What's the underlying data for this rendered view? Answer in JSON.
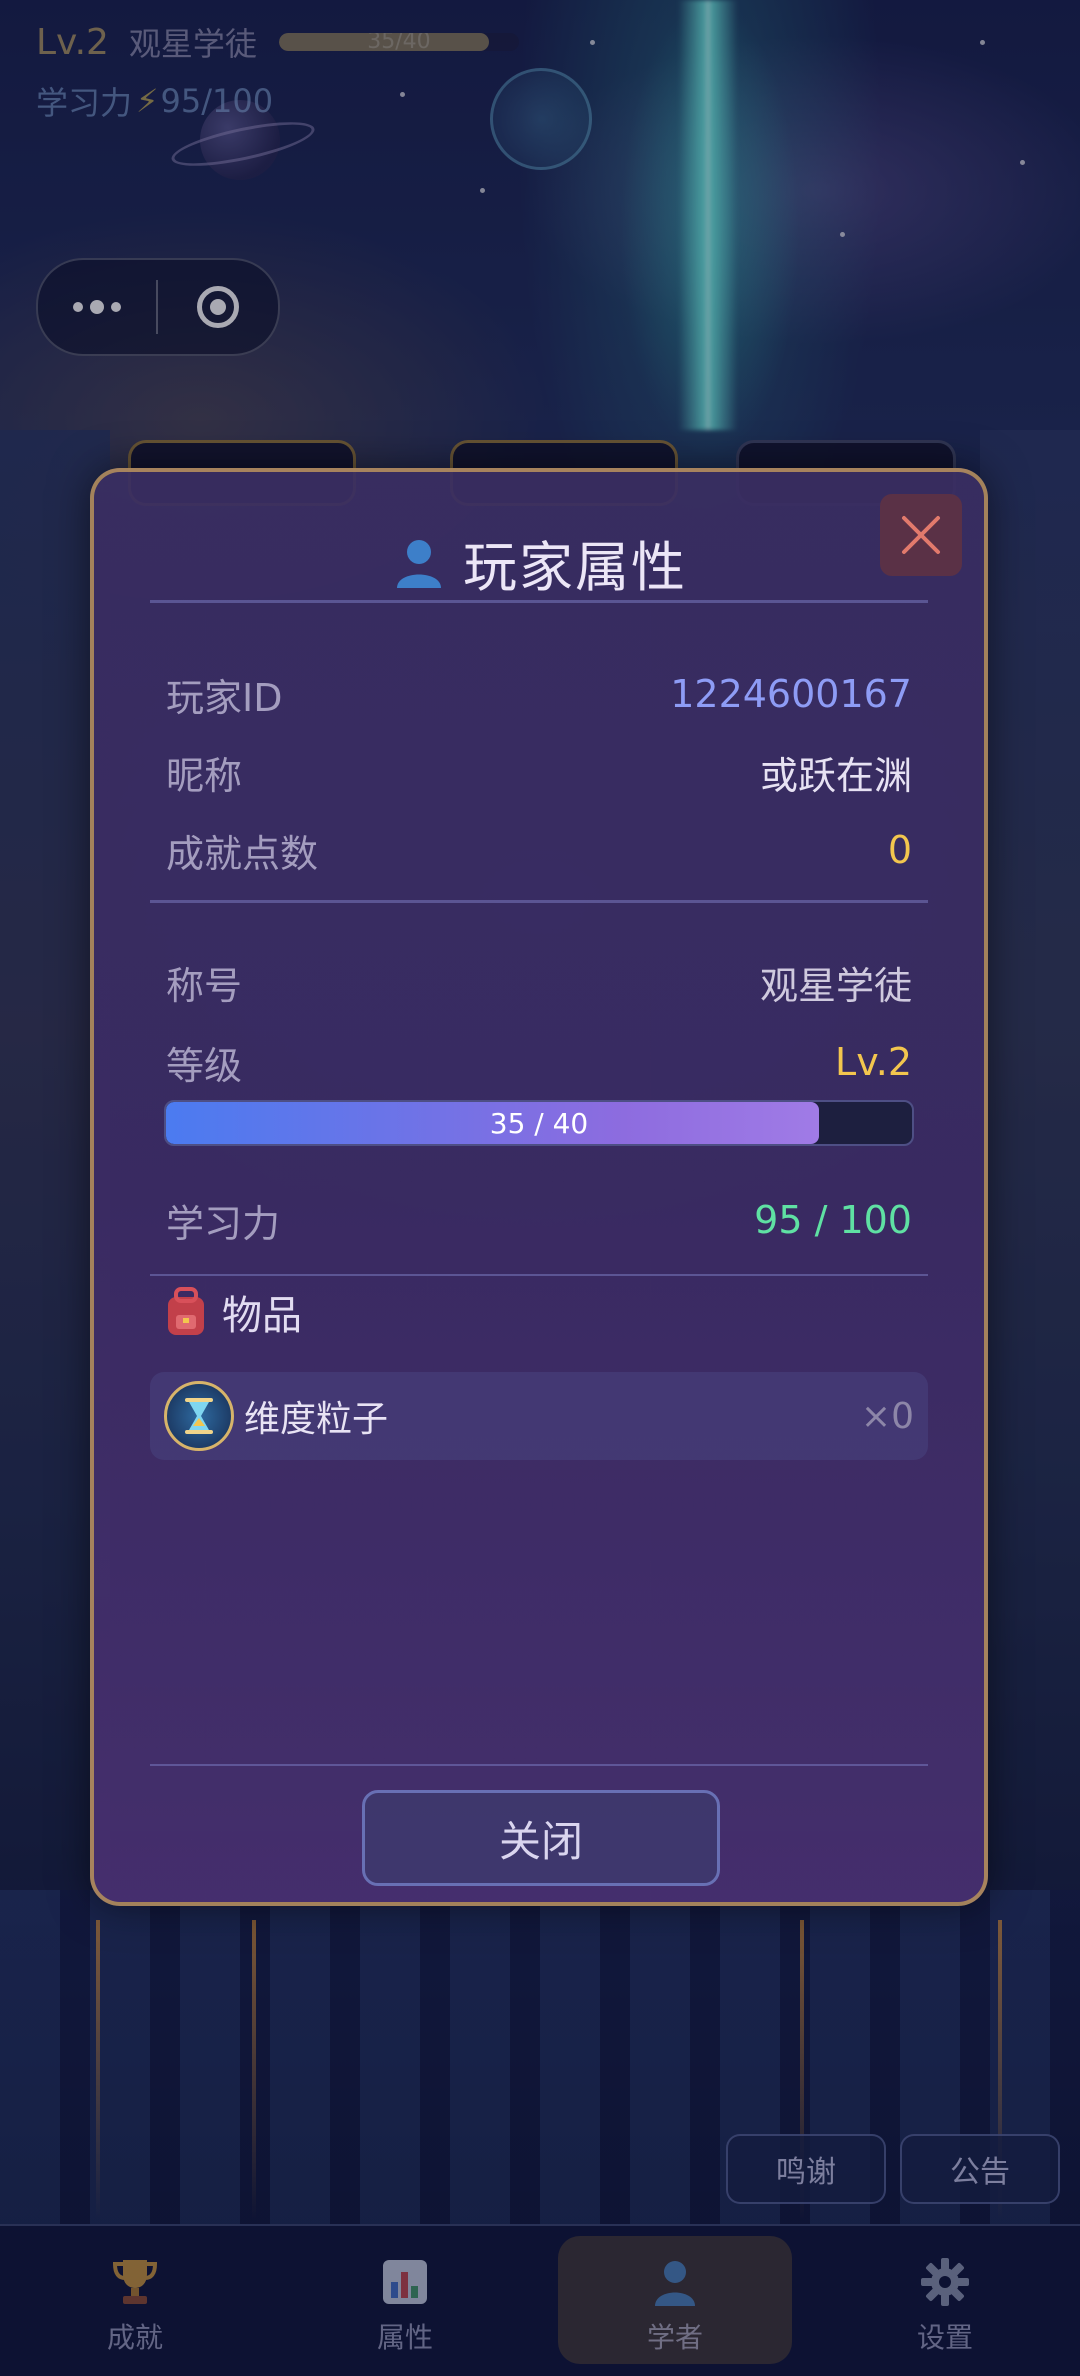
{
  "hud": {
    "level": "Lv.2",
    "title": "观星学徒",
    "xp_text": "35/40",
    "xp_fraction": 0.875,
    "stamina_label": "学习力",
    "stamina_value": "95/100"
  },
  "modal": {
    "title": "玩家属性",
    "rows": {
      "player_id": {
        "label": "玩家ID",
        "value": "1224600167"
      },
      "nickname": {
        "label": "昵称",
        "value": "或跃在渊"
      },
      "achievement_points": {
        "label": "成就点数",
        "value": "0"
      },
      "rank_title": {
        "label": "称号",
        "value": "观星学徒"
      },
      "level": {
        "label": "等级",
        "value": "Lv.2"
      },
      "study_power": {
        "label": "学习力",
        "value": "95 / 100"
      }
    },
    "xp_bar": {
      "text": "35 / 40",
      "fraction": 0.875
    },
    "items_header": "物品",
    "items": [
      {
        "name": "维度粒子",
        "count": "×0",
        "icon": "hourglass-icon"
      }
    ],
    "close_button": "关闭"
  },
  "floating_buttons": {
    "thanks": "鸣谢",
    "notice": "公告"
  },
  "tabbar": {
    "tabs": [
      {
        "label": "成就",
        "icon": "trophy-icon"
      },
      {
        "label": "属性",
        "icon": "bar-chart-icon"
      },
      {
        "label": "学者",
        "icon": "scholar-icon",
        "active": true
      },
      {
        "label": "设置",
        "icon": "gear-icon"
      }
    ]
  },
  "colors": {
    "accent_gold": "#f3c64e",
    "value_blue": "#8e9cf5",
    "value_green": "#5fe1a3",
    "modal_border": "#c8a05a"
  }
}
